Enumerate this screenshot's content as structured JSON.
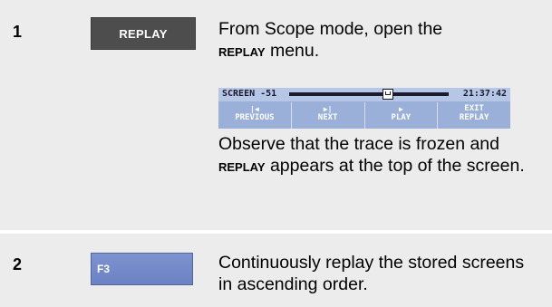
{
  "steps": [
    {
      "number": "1",
      "key_label": "REPLAY",
      "text_before": "From Scope mode, open the",
      "text_bold": "REPLAY",
      "text_after": " menu.",
      "observe_before": "Observe that the trace is frozen and ",
      "observe_bold": "REPLAY",
      "observe_after": " appears at the top of the screen."
    },
    {
      "number": "2",
      "key_label": "F3",
      "text": "Continuously replay the stored screens in ascending order."
    }
  ],
  "screen": {
    "title": "SCREEN -51",
    "time": "21:37:42",
    "softkeys": [
      {
        "icon": "skip-back-icon",
        "glyph": "|◀",
        "label_line1": "PREVIOUS",
        "label_line2": ""
      },
      {
        "icon": "skip-forward-icon",
        "glyph": "▶|",
        "label_line1": "NEXT",
        "label_line2": ""
      },
      {
        "icon": "play-icon",
        "glyph": "▶",
        "label_line1": "PLAY",
        "label_line2": ""
      },
      {
        "icon": "",
        "glyph": "",
        "label_line1": "EXIT",
        "label_line2": "REPLAY"
      }
    ]
  }
}
